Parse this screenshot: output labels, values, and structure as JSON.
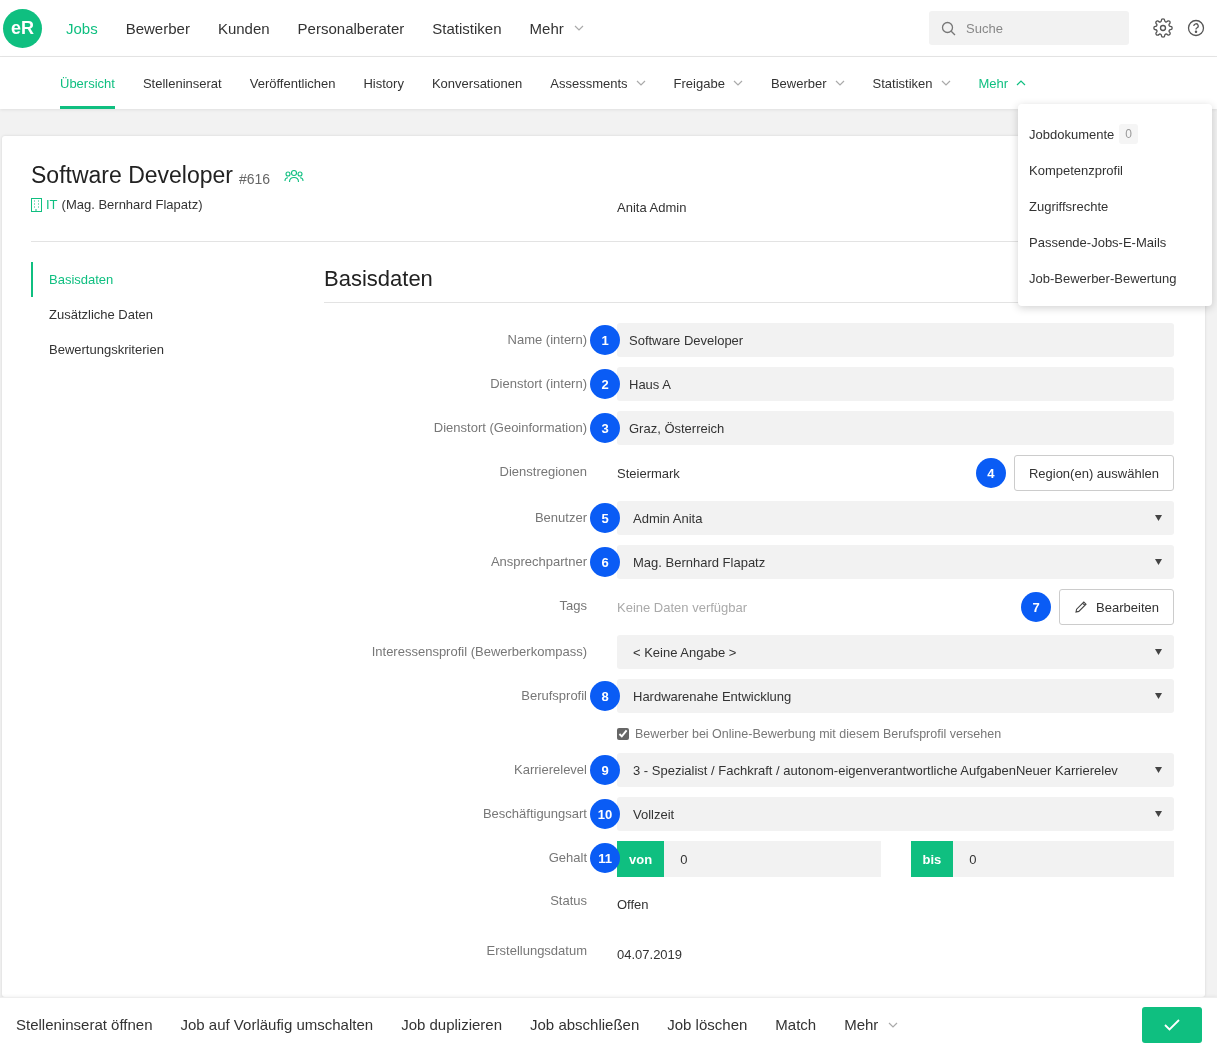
{
  "logo": "eR",
  "top_nav": [
    {
      "label": "Jobs",
      "selected": true,
      "dropdown": false
    },
    {
      "label": "Bewerber",
      "selected": false,
      "dropdown": false
    },
    {
      "label": "Kunden",
      "selected": false,
      "dropdown": false
    },
    {
      "label": "Personalberater",
      "selected": false,
      "dropdown": false
    },
    {
      "label": "Statistiken",
      "selected": false,
      "dropdown": false
    },
    {
      "label": "Mehr",
      "selected": false,
      "dropdown": true
    }
  ],
  "search": {
    "placeholder": "Suche"
  },
  "sub_nav": [
    {
      "label": "Übersicht",
      "selected": true,
      "dropdown": false,
      "expanded": false
    },
    {
      "label": "Stelleninserat",
      "selected": false,
      "dropdown": false,
      "expanded": false
    },
    {
      "label": "Veröffentlichen",
      "selected": false,
      "dropdown": false,
      "expanded": false
    },
    {
      "label": "History",
      "selected": false,
      "dropdown": false,
      "expanded": false
    },
    {
      "label": "Konversationen",
      "selected": false,
      "dropdown": false,
      "expanded": false
    },
    {
      "label": "Assessments",
      "selected": false,
      "dropdown": true,
      "expanded": false
    },
    {
      "label": "Freigabe",
      "selected": false,
      "dropdown": true,
      "expanded": false
    },
    {
      "label": "Bewerber",
      "selected": false,
      "dropdown": true,
      "expanded": false
    },
    {
      "label": "Statistiken",
      "selected": false,
      "dropdown": true,
      "expanded": false
    },
    {
      "label": "Mehr",
      "selected": false,
      "dropdown": true,
      "expanded": true
    }
  ],
  "more_menu": [
    {
      "label": "Jobdokumente",
      "count": "0"
    },
    {
      "label": "Kompetenzprofil"
    },
    {
      "label": "Zugriffsrechte"
    },
    {
      "label": "Passende-Jobs-E-Mails"
    },
    {
      "label": "Job-Bewerber-Bewertung"
    }
  ],
  "job": {
    "title": "Software Developer",
    "number": "#616",
    "department": "IT",
    "contact": "(Mag. Bernhard Flapatz)",
    "owner": "Anita Admin"
  },
  "side_nav": [
    {
      "label": "Basisdaten",
      "selected": true
    },
    {
      "label": "Zusätzliche Daten",
      "selected": false
    },
    {
      "label": "Bewertungskriterien",
      "selected": false
    }
  ],
  "section_title": "Basisdaten",
  "fields": [
    {
      "kind": "input",
      "label": "Name (intern)",
      "marker": "1",
      "value": "Software Developer"
    },
    {
      "kind": "input",
      "label": "Dienstort (intern)",
      "marker": "2",
      "value": "Haus A"
    },
    {
      "kind": "input",
      "label": "Dienstort (Geoinformation)",
      "marker": "3",
      "value": "Graz, Österreich"
    },
    {
      "kind": "action",
      "label": "Dienstregionen",
      "marker": "4",
      "value": "Steiermark",
      "button": "Region(en) auswählen",
      "muted": false
    },
    {
      "kind": "select",
      "label": "Benutzer",
      "marker": "5",
      "value": "Admin Anita"
    },
    {
      "kind": "select",
      "label": "Ansprechpartner",
      "marker": "6",
      "value": "Mag. Bernhard Flapatz"
    },
    {
      "kind": "edit",
      "label": "Tags",
      "marker": "7",
      "value": "Keine Daten verfügbar",
      "button": "Bearbeiten",
      "muted": true
    },
    {
      "kind": "select",
      "label": "Interessensprofil (Bewerberkompass)",
      "value": "< Keine Angabe >"
    },
    {
      "kind": "select",
      "label": "Berufsprofil",
      "marker": "8",
      "value": "Hardwarenahe Entwicklung"
    },
    {
      "kind": "checkbox",
      "label": "Bewerber bei Online-Bewerbung mit diesem Berufsprofil versehen",
      "checked": true
    },
    {
      "kind": "select",
      "label": "Karrierelevel",
      "marker": "9",
      "value": "3 - Spezialist / Fachkraft / autonom-eigenverantwortliche AufgabenNeuer Karrierelev"
    },
    {
      "kind": "select",
      "label": "Beschäftigungsart",
      "marker": "10",
      "value": "Vollzeit"
    },
    {
      "kind": "salary",
      "label": "Gehalt",
      "marker": "11",
      "from_label": "von",
      "from_value": "0",
      "to_label": "bis",
      "to_value": "0"
    },
    {
      "kind": "static",
      "label": "Status",
      "value": "Offen"
    },
    {
      "kind": "static",
      "label": "Erstellungsdatum",
      "value": "04.07.2019"
    }
  ],
  "actions": [
    {
      "label": "Stelleninserat öffnen",
      "dropdown": false
    },
    {
      "label": "Job auf Vorläufig umschalten",
      "dropdown": false
    },
    {
      "label": "Job duplizieren",
      "dropdown": false
    },
    {
      "label": "Job abschließen",
      "dropdown": false
    },
    {
      "label": "Job löschen",
      "dropdown": false
    },
    {
      "label": "Match",
      "dropdown": false
    },
    {
      "label": "Mehr",
      "dropdown": true
    }
  ]
}
